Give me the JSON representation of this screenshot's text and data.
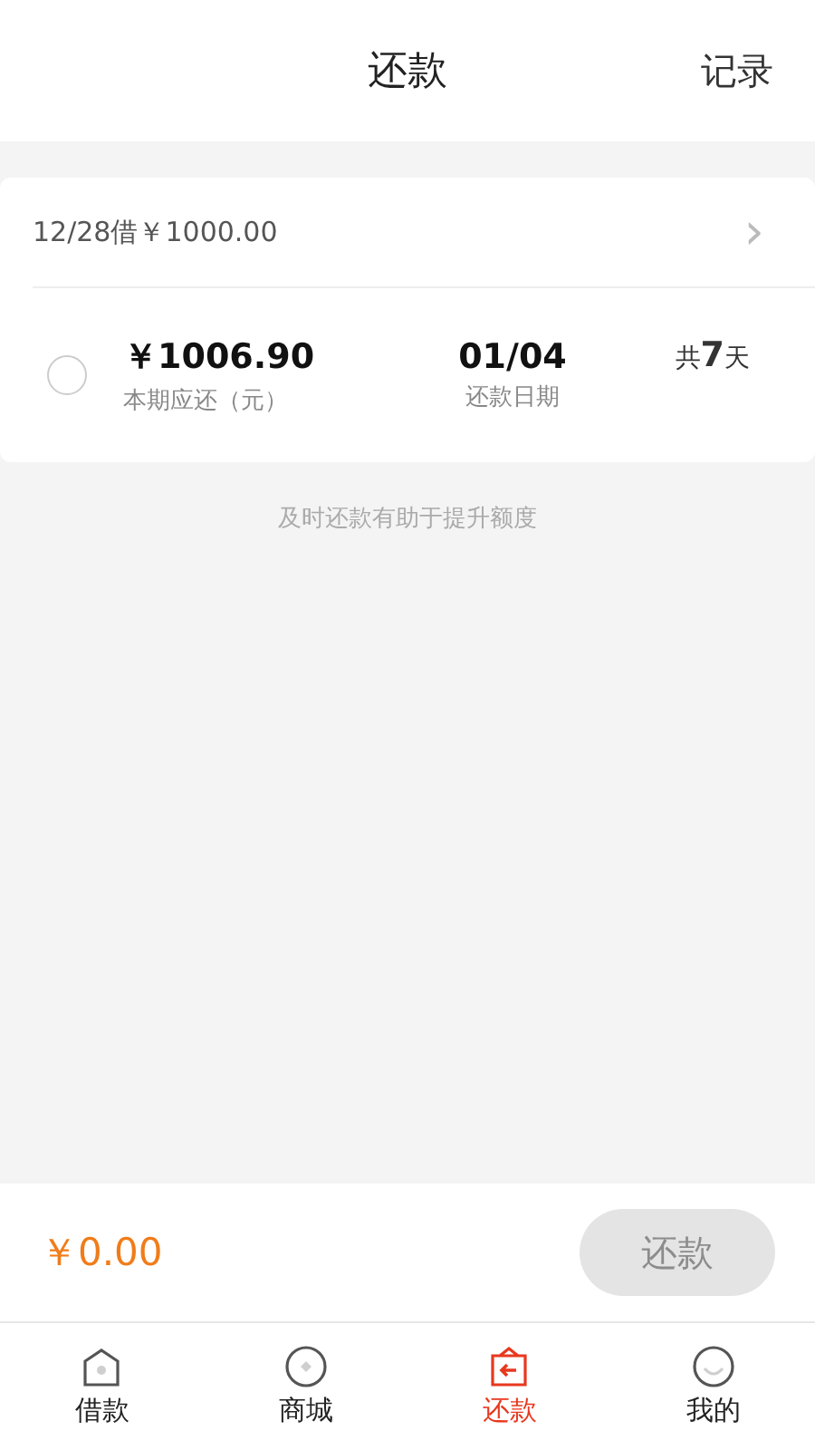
{
  "header": {
    "title": "还款",
    "action": "记录"
  },
  "loan": {
    "title": "12/28借￥1000.00",
    "chevron": "›",
    "installments": [
      {
        "amount": "￥1006.90",
        "amount_label": "本期应还（元）",
        "date": "01/04",
        "date_label": "还款日期",
        "duration": "共**7**天",
        "selected": false
      }
    ]
  },
  "tip": "及时还款有助于提升额度",
  "footer": {
    "total": "￥0.00",
    "button": "还款",
    "disabled": true
  },
  "tabs": [
    {
      "label": "借款",
      "kind": "home",
      "selected": false
    },
    {
      "label": "商城",
      "kind": "shop",
      "selected": false
    },
    {
      "label": "还款",
      "kind": "repay",
      "selected": true
    },
    {
      "label": "我的",
      "kind": "profile",
      "selected": false
    }
  ]
}
